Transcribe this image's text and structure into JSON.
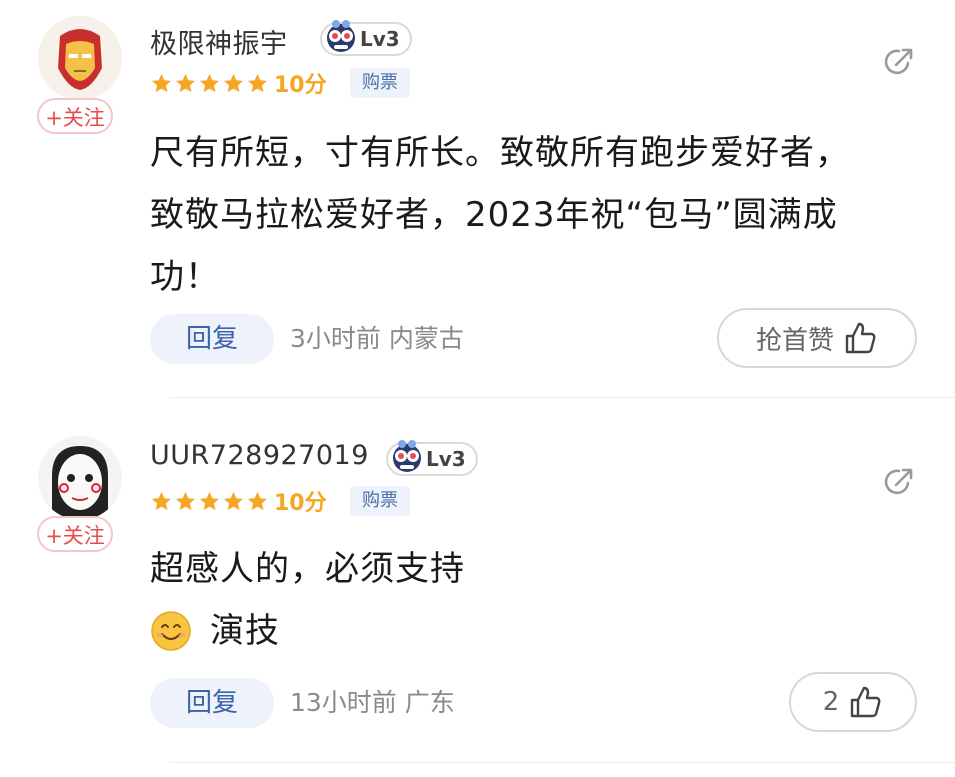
{
  "comments": [
    {
      "username": "极限神振宇",
      "level": "Lv3",
      "score": "10分",
      "tag": "购票",
      "follow": "+关注",
      "lines": [
        "尺有所短，寸有所长。致敬所有跑步爱好者，",
        "致敬马拉松爱好者，2023年祝“包马”圆满成",
        "功！"
      ],
      "reply": "回复",
      "meta": "3小时前 内蒙古",
      "like": "抢首赞",
      "avatar_icon": "iron-man-avatar-icon",
      "rating": 5
    },
    {
      "username": "UUR728927019",
      "level": "Lv3",
      "score": "10分",
      "tag": "购票",
      "follow": "+关注",
      "lines": [
        "超感人的，必须支持"
      ],
      "emoji_text": "演技",
      "reply": "回复",
      "meta": "13小时前 广东",
      "like": "2",
      "avatar_icon": "mask-avatar-icon",
      "rating": 5
    }
  ],
  "colors": {
    "star": "#f5a623",
    "follow": "#e84b4b",
    "reply_bg": "#eef2fa",
    "reply_text": "#3b64a8",
    "tag_bg": "#eef3fb"
  }
}
